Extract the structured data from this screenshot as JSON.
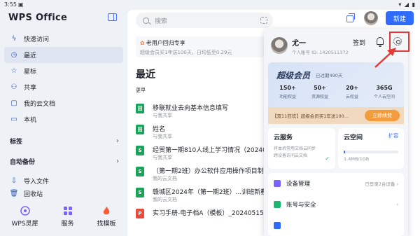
{
  "status": {
    "time": "3:55"
  },
  "sidebar": {
    "brand": "WPS Office",
    "items": [
      {
        "label": "快速访问",
        "icon": "flash-icon"
      },
      {
        "label": "最近",
        "icon": "clock-icon"
      },
      {
        "label": "星标",
        "icon": "star-icon"
      },
      {
        "label": "共享",
        "icon": "share-icon"
      },
      {
        "label": "我的云文档",
        "icon": "cloud-doc-icon"
      },
      {
        "label": "本机",
        "icon": "device-icon"
      }
    ],
    "sections": [
      {
        "label": "标签"
      },
      {
        "label": "自动备份"
      }
    ],
    "lower_items": [
      {
        "label": "导入文件"
      },
      {
        "label": "回收站"
      }
    ],
    "bottom": [
      {
        "label": "WPS灵犀"
      },
      {
        "label": "服务"
      },
      {
        "label": "找模板"
      }
    ]
  },
  "header": {
    "search_placeholder": "搜索",
    "new_label": "新建"
  },
  "promo": {
    "title": "老用户回归专享",
    "subtitle": "超级会员买1年送100天，日均低至0.29元"
  },
  "main": {
    "title": "最近",
    "sort_label": "更早",
    "files": [
      {
        "type": "table",
        "badge": "田",
        "name": "移联就业去向基本信息填写",
        "sub": "与我共享",
        "color": "#1aa35a"
      },
      {
        "type": "table",
        "badge": "田",
        "name": "姓名",
        "sub": "与我共享",
        "color": "#1aa35a"
      },
      {
        "type": "sheet",
        "badge": "S",
        "name": "经贸第一期810人线上学习情况（20240",
        "sub": "与我共享",
        "color": "#1aa35a"
      },
      {
        "type": "sheet",
        "badge": "S",
        "name": "（第一期2班）办公软件应用操作项目制",
        "sub": "我的云文档",
        "color": "#1aa35a"
      },
      {
        "type": "sheet",
        "badge": "S",
        "name": "赣城区2024年（第一期2班）...训班新教",
        "sub": "我的云文档",
        "color": "#1aa35a"
      },
      {
        "type": "pdf",
        "badge": "P",
        "name": "实习手册-电子档A（模板）_20240515231018",
        "sub": "",
        "color": "#e84a3c"
      }
    ]
  },
  "popup": {
    "name": "尤一",
    "account": "个人账号 ID: 1420511372",
    "sign_label": "签到",
    "vip": {
      "title": "超级会员",
      "since": "已过期490天",
      "stats": [
        {
          "value": "150+",
          "label": "功能权益"
        },
        {
          "value": "50+",
          "label": "资源权益"
        },
        {
          "value": "20+",
          "label": "云权益"
        },
        {
          "value": "365G",
          "label": "个人云空间"
        }
      ],
      "promo_text": "【双11狂欢】超级会员买1年送100...",
      "renew_label": "立即续费"
    },
    "cloud_service": {
      "title": "云服务",
      "desc1": "将本机常用文档云同步",
      "desc2": "跨设备访问云文档"
    },
    "cloud_space": {
      "title": "云空间",
      "expand_label": "扩容",
      "usage": "1.4MB/1GB",
      "usage_fraction": 0.0014
    },
    "menu": [
      {
        "label": "设备管理",
        "right": "已登录2台设备",
        "color": "#7b61ff"
      },
      {
        "label": "账号与安全",
        "right": "",
        "color": "#19b86c"
      },
      {
        "label": "",
        "right": "",
        "color": "#2f6bff"
      }
    ]
  },
  "colors": {
    "accent": "#2f6bff",
    "highlight": "#e53935"
  }
}
